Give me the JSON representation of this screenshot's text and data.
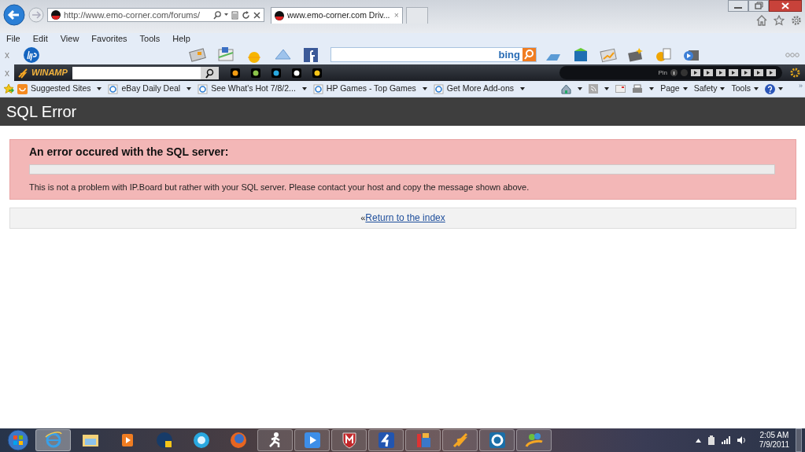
{
  "browser": {
    "address": "http://www.emo-corner.com/forums/",
    "tab": {
      "title": "www.emo-corner.com Driv...",
      "close": "×",
      "selected": true
    }
  },
  "menu_bar": [
    "File",
    "Edit",
    "View",
    "Favorites",
    "Tools",
    "Help"
  ],
  "hp_toolbar": {
    "close": "x",
    "search_logo": "bing"
  },
  "winamp_toolbar": {
    "close": "x",
    "logo": "WINAMP",
    "pin_label": "Pin"
  },
  "favorites_bar": {
    "items": [
      {
        "label": "Suggested Sites"
      },
      {
        "label": "eBay Daily Deal"
      },
      {
        "label": "See What's Hot 7/8/2..."
      },
      {
        "label": "HP Games - Top Games"
      },
      {
        "label": "Get More Add-ons"
      }
    ],
    "overflow": "»"
  },
  "command_bar": {
    "menus": [
      "Page",
      "Safety",
      "Tools"
    ]
  },
  "page": {
    "title": "SQL Error",
    "error": {
      "heading": "An error occured with the SQL server:",
      "message": "This is not a problem with IP.Board but rather with your SQL server. Please contact your host and copy the message shown above."
    },
    "return": {
      "prefix": "«",
      "link": "Return to the index"
    }
  },
  "taskbar": {
    "buttons": [
      {
        "running": true
      },
      {
        "running": false
      },
      {
        "running": false
      },
      {
        "running": false
      },
      {
        "running": false
      },
      {
        "running": false
      },
      {
        "running": true
      },
      {
        "running": true
      },
      {
        "running": true
      },
      {
        "running": true
      },
      {
        "running": true
      },
      {
        "running": true
      },
      {
        "running": true
      },
      {
        "running": true
      }
    ],
    "clock": {
      "time": "2:05 AM",
      "date": "7/9/2011"
    }
  }
}
